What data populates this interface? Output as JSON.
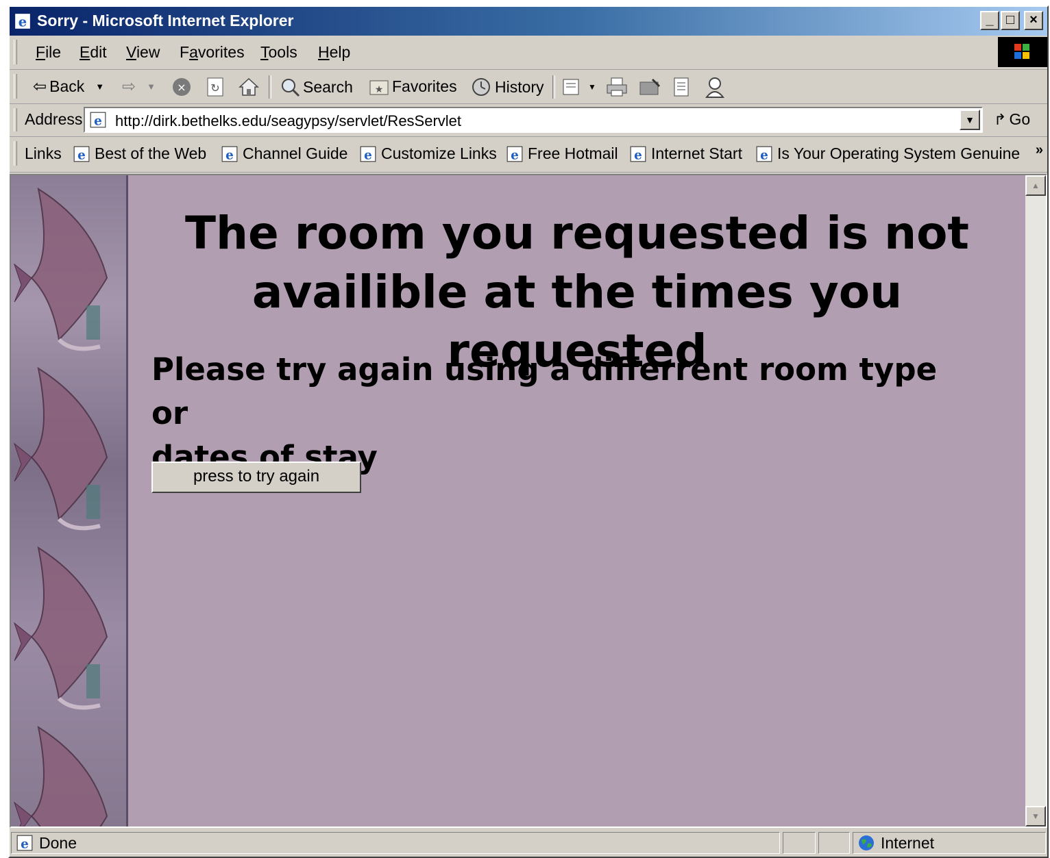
{
  "window": {
    "title": "Sorry - Microsoft Internet Explorer",
    "controls": {
      "minimize": "_",
      "maximize": "□",
      "close": "×"
    }
  },
  "menu": {
    "items": [
      {
        "label": "File",
        "accel": "F",
        "rest": "ile"
      },
      {
        "label": "Edit",
        "accel": "E",
        "rest": "dit"
      },
      {
        "label": "View",
        "accel": "V",
        "rest": "iew"
      },
      {
        "label": "Favorites",
        "accel": "a",
        "pre": "F",
        "rest": "vorites"
      },
      {
        "label": "Tools",
        "accel": "T",
        "rest": "ools"
      },
      {
        "label": "Help",
        "accel": "H",
        "rest": "elp"
      }
    ]
  },
  "toolbar": {
    "back": "Back",
    "search": "Search",
    "favorites": "Favorites",
    "history": "History"
  },
  "address": {
    "label": "Address",
    "url": "http://dirk.bethelks.edu/seagypsy/servlet/ResServlet",
    "go": "Go"
  },
  "links": {
    "label": "Links",
    "items": [
      "Best of the Web",
      "Channel Guide",
      "Customize Links",
      "Free Hotmail",
      "Internet Start",
      "Is Your Operating System Genuine"
    ],
    "more": "»"
  },
  "page": {
    "headline_line1": "The room you requested is not",
    "headline_line2": "availible at the times you requested",
    "subhead_line1": "Please try again using a differrent room type or",
    "subhead_line2": "dates of stay",
    "button": "press to try again"
  },
  "status": {
    "text": "Done",
    "zone": "Internet"
  },
  "colors": {
    "page_bg": "#b19fb1",
    "chrome": "#d4d0c8",
    "titlebar_start": "#0a246a"
  }
}
